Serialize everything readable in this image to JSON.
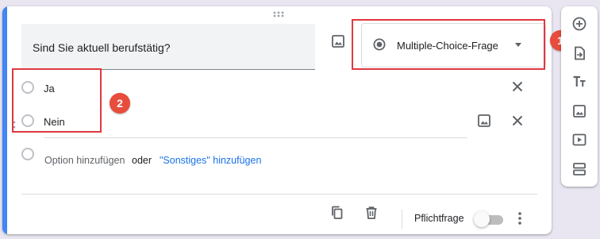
{
  "question": {
    "title": "Sind Sie aktuell berufstätig?"
  },
  "question_type": {
    "selected_label": "Multiple-Choice-Frage"
  },
  "options": [
    {
      "label": "Ja"
    },
    {
      "label": "Nein"
    }
  ],
  "add_option": {
    "add_label": "Option hinzufügen",
    "separator": "oder",
    "add_other_label": "\"Sonstiges\" hinzufügen"
  },
  "footer": {
    "required_label": "Pflichtfrage",
    "required_on": false
  },
  "annotations": {
    "badge_1": "1",
    "badge_2": "2"
  },
  "colors": {
    "accent": "#4285f4",
    "link": "#1a73e8",
    "annotation": "#e0383f"
  },
  "icons": {
    "toolbar": [
      "add-question-icon",
      "import-questions-icon",
      "add-title-icon",
      "add-image-icon",
      "add-video-icon",
      "add-section-icon"
    ],
    "footer": [
      "duplicate-icon",
      "delete-icon",
      "more-vert-icon"
    ]
  }
}
